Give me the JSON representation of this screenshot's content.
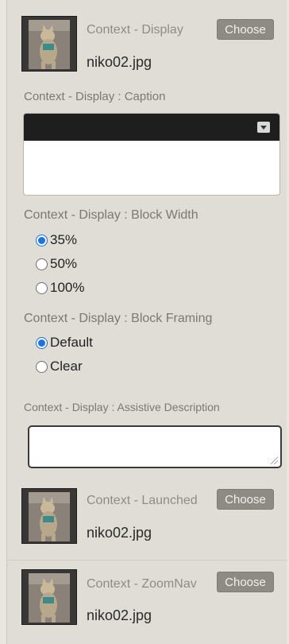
{
  "display": {
    "title": "Context - Display",
    "filename": "niko02.jpg",
    "choose_label": "Choose"
  },
  "caption": {
    "label": "Context - Display : Caption"
  },
  "block_width": {
    "label": "Context - Display : Block Width",
    "options": [
      "35%",
      "50%",
      "100%"
    ],
    "selected": "35%"
  },
  "block_framing": {
    "label": "Context - Display : Block Framing",
    "options": [
      "Default",
      "Clear"
    ],
    "selected": "Default"
  },
  "assistive": {
    "label": "Context - Display : Assistive Description",
    "value": ""
  },
  "launched": {
    "title": "Context - Launched",
    "filename": "niko02.jpg",
    "choose_label": "Choose"
  },
  "zoomnav": {
    "title": "Context - ZoomNav",
    "filename": "niko02.jpg",
    "choose_label": "Choose"
  },
  "colors": {
    "panel_bg": "#e0ddd6",
    "button_bg": "#8e8a84",
    "toolbar_bg": "#1e1e1e",
    "radio_accent": "#1a73e8"
  }
}
